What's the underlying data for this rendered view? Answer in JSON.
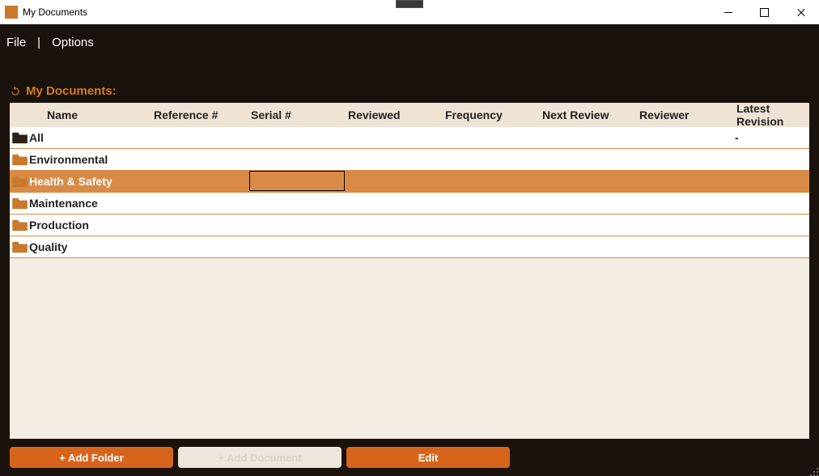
{
  "window": {
    "title": "My Documents"
  },
  "menu": {
    "file": "File",
    "options": "Options"
  },
  "section": {
    "title": "My Documents:"
  },
  "columns": {
    "name": "Name",
    "reference": "Reference #",
    "serial": "Serial #",
    "reviewed": "Reviewed",
    "frequency": "Frequency",
    "next_review": "Next Review",
    "reviewer": "Reviewer",
    "latest_revision": "Latest Revision"
  },
  "rows": [
    {
      "name": "All",
      "latest_revision": "-",
      "dark": true,
      "selected": false
    },
    {
      "name": "Environmental",
      "latest_revision": "",
      "dark": false,
      "selected": false
    },
    {
      "name": "Health & Safety",
      "latest_revision": "",
      "dark": false,
      "selected": true
    },
    {
      "name": "Maintenance",
      "latest_revision": "",
      "dark": false,
      "selected": false
    },
    {
      "name": "Production",
      "latest_revision": "",
      "dark": false,
      "selected": false
    },
    {
      "name": "Quality",
      "latest_revision": "",
      "dark": false,
      "selected": false
    }
  ],
  "buttons": {
    "add_folder": "+ Add Folder",
    "add_document": "+ Add Document",
    "edit": "Edit"
  }
}
